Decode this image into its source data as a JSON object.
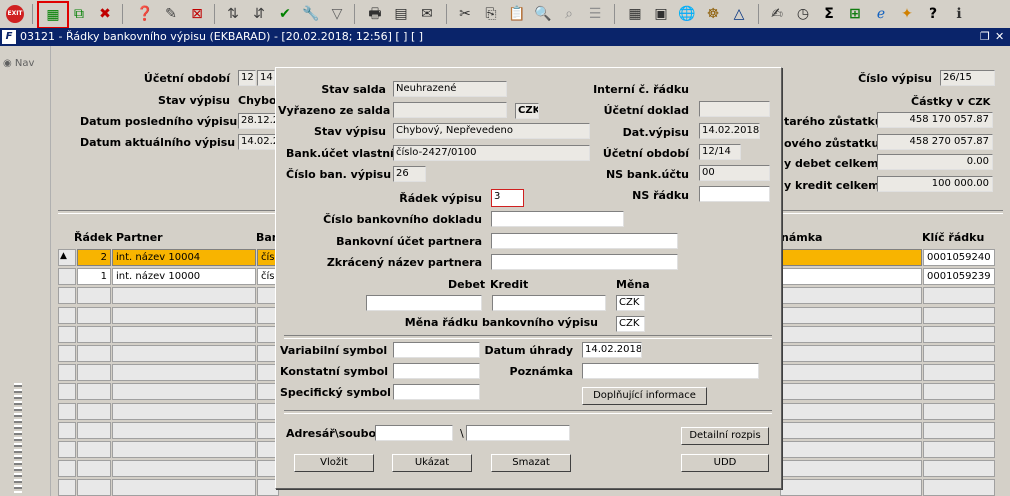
{
  "toolbar": {
    "exit_label": "EXIT"
  },
  "window": {
    "title": "03121 - Řádky bankovního výpisu (EKBARAD) - [20.02.2018; 12:56] [ ] [ ]",
    "logo": "F"
  },
  "left": {
    "nav_label": "Nav"
  },
  "main": {
    "ucetni_obdobi_label": "Účetní období",
    "ucetni_obdobi_v1": "12",
    "ucetni_obdobi_v2": "14",
    "stav_vypisu_label": "Stav výpisu",
    "stav_vypisu_value": "Chybov",
    "datum_posl_label": "Datum posledního výpisu",
    "datum_posl_value": "28.12.2",
    "datum_akt_label": "Datum aktuálního výpisu",
    "datum_akt_value": "14.02.2",
    "cislo_vypisu_label": "Číslo výpisu",
    "cislo_vypisu_value": "26/15",
    "castky_label": "Částky v",
    "castky_currency": "CZK",
    "stareho_label": "tarého zůstatku",
    "stareho_value": "458 170 057.87",
    "noveho_label": "ového zůstatku",
    "noveho_value": "458 270 057.87",
    "debet_celkem_label": "y debet celkem",
    "debet_celkem_value": "0.00",
    "kredit_celkem_label": "y kredit celkem",
    "kredit_celkem_value": "100 000.00"
  },
  "grid": {
    "headers": {
      "radek": "Řádek",
      "partner": "Partner",
      "ban": "Ban",
      "poznamka": "námka",
      "klic": "Klíč řádku"
    },
    "rows": [
      {
        "radek": "2",
        "partner": "int. název 10004",
        "ban": "čísl",
        "klic": "0001059240"
      },
      {
        "radek": "1",
        "partner": "int. název 10000",
        "ban": "čísl",
        "klic": "0001059239"
      }
    ]
  },
  "dialog": {
    "stav_salda_label": "Stav salda",
    "stav_salda_value": "Neuhrazené",
    "vyrazeno_label": "Vyřazeno ze salda",
    "vyrazeno_currency": "CZK",
    "stav_vypisu_label": "Stav výpisu",
    "stav_vypisu_value": "Chybový, Nepřevedeno",
    "bank_ucet_label": "Bank.účet vlastní",
    "bank_ucet_value": "číslo-2427/0100",
    "cislo_ban_label": "Číslo ban. výpisu",
    "cislo_ban_value": "26",
    "interni_label": "Interní č. řádku",
    "ucetni_doklad_label": "Účetní doklad",
    "dat_vypisu_label": "Dat.výpisu",
    "dat_vypisu_value": "14.02.2018",
    "ucetni_obdobi_label": "Účetní období",
    "ucetni_obdobi_value": "12/14",
    "ns_bank_label": "NS bank.účtu",
    "ns_bank_value": "00",
    "ns_radku_label": "NS řádku",
    "radek_vypisu_label": "Řádek výpisu",
    "radek_vypisu_value": "3",
    "cislo_bank_dokladu_label": "Číslo bankovního dokladu",
    "bank_ucet_partnera_label": "Bankovní účet partnera",
    "zkraceny_label": "Zkrácený název partnera",
    "debet_label": "Debet",
    "kredit_label": "Kredit",
    "mena_label": "Měna",
    "mena_value": "CZK",
    "mena_radku_label": "Měna řádku bankovního výpisu",
    "mena_radku_value": "CZK",
    "variabilni_label": "Variabilní symbol",
    "konstantni_label": "Konstatní symbol",
    "specificky_label": "Specifický symbol",
    "datum_uhrady_label": "Datum úhrady",
    "datum_uhrady_value": "14.02.2018",
    "poznamka_label": "Poznámka",
    "doplnujici_button": "Doplňující informace",
    "adresar_label": "Adresář\\soubor",
    "backslash": "\\",
    "detailni_button": "Detailní rozpis",
    "vlozit_button": "Vložit",
    "ukazat_button": "Ukázat",
    "smazat_button": "Smazat",
    "udd_button": "UDD"
  }
}
